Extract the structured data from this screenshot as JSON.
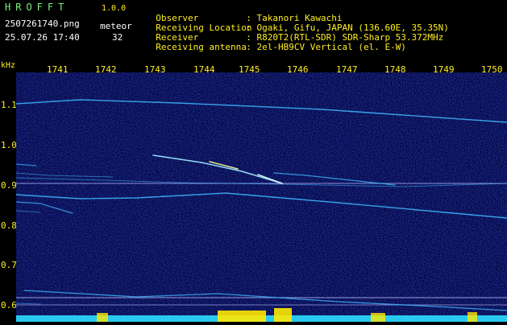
{
  "header": {
    "title": "HROFFT",
    "version": "1.0.0",
    "filename": "2507261740.png",
    "meteor_label": "meteor",
    "datetime": "25.07.26 17:40",
    "meteor_count": "32"
  },
  "meta": [
    {
      "key": "Observer",
      "sep": ":",
      "value": "Takanori Kawachi"
    },
    {
      "key": "Receiving Location",
      "sep": ":",
      "value": "Ogaki, Gifu, JAPAN (136.60E, 35.35N)"
    },
    {
      "key": "Receiver",
      "sep": ":",
      "value": "R820T2(RTL-SDR) SDR-Sharp 53.372MHz"
    },
    {
      "key": "Receiving antenna",
      "sep": ":",
      "value": "2el-HB9CV Vertical (el. E-W)"
    }
  ],
  "axis": {
    "y_unit": "kHz",
    "x_ticks": [
      "1741",
      "1742",
      "1743",
      "1744",
      "1745",
      "1746",
      "1747",
      "1748",
      "1749",
      "1750"
    ],
    "y_ticks": [
      "1.1",
      "1.0",
      "0.9",
      "0.8",
      "0.7",
      "0.6"
    ]
  },
  "colors": {
    "background": "#00003a",
    "trace": "#3fb8ff",
    "label": "#ffee22",
    "title": "#7cf07c",
    "level_bar": "#27c9f0"
  }
}
